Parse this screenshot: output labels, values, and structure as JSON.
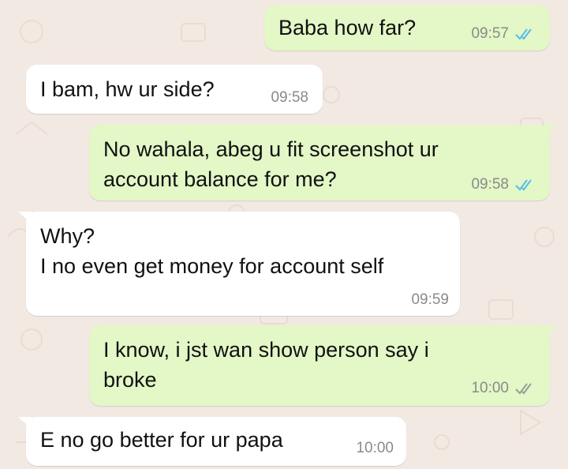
{
  "theme": {
    "outgoing_bubble": "#e3f7c7",
    "incoming_bubble": "#ffffff",
    "timestamp_color": "#8a8a8a",
    "read_ticks_color": "#53bdeb",
    "wallpaper": "#f3e9e3"
  },
  "messages": [
    {
      "direction": "outgoing",
      "text": "Baba how far?",
      "time": "09:57",
      "status_icon": "double-check-read-icon"
    },
    {
      "direction": "incoming",
      "text": "I bam, hw ur side?",
      "time": "09:58"
    },
    {
      "direction": "outgoing",
      "text": "No wahala, abeg u fit screenshot ur\naccount balance for me?",
      "time": "09:58",
      "status_icon": "double-check-read-icon"
    },
    {
      "direction": "incoming",
      "text": "Why?\nI no even get money for account self",
      "time": "09:59"
    },
    {
      "direction": "outgoing",
      "text": "I know, i jst wan show person say i\nbroke",
      "time": "10:00",
      "status_icon": "double-check-delivered-icon"
    },
    {
      "direction": "incoming",
      "text": "E no go better for ur papa",
      "time": "10:00"
    }
  ]
}
